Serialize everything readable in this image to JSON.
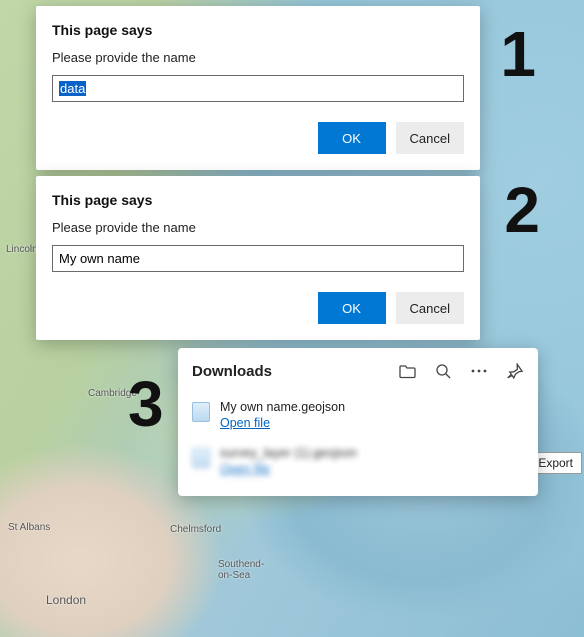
{
  "steps": {
    "one": "1",
    "two": "2",
    "three": "3"
  },
  "dialog1": {
    "title": "This page says",
    "message": "Please provide the name",
    "value": "data",
    "ok": "OK",
    "cancel": "Cancel"
  },
  "dialog2": {
    "title": "This page says",
    "message": "Please provide the name",
    "value": "My own name",
    "ok": "OK",
    "cancel": "Cancel"
  },
  "downloads": {
    "title": "Downloads",
    "items": [
      {
        "name": "My own name.geojson",
        "action": "Open file"
      },
      {
        "name": "survey_layer (1).geojson",
        "action": "Open file"
      }
    ]
  },
  "map": {
    "export": "Export",
    "labels": {
      "lincoln": "Lincoln",
      "cambridge": "Cambridge",
      "stalbans": "St Albans",
      "chelmsford": "Chelmsford",
      "london": "London",
      "southend": "Southend-\non-Sea"
    }
  }
}
